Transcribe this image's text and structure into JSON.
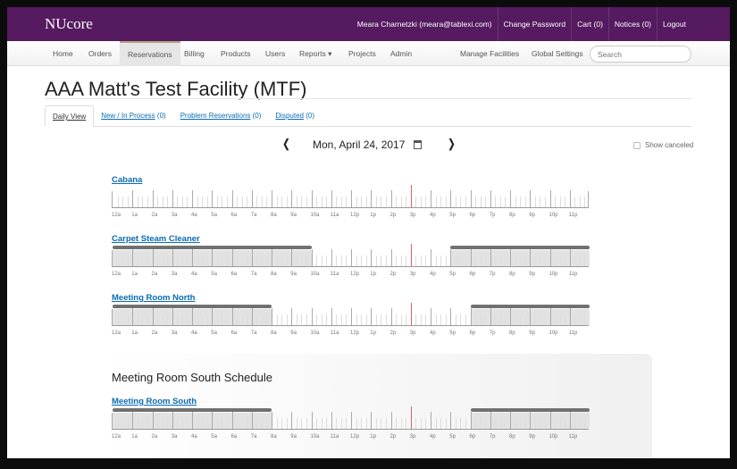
{
  "header": {
    "logo": "NUcore",
    "links": [
      "Meara Charnetzki (meara@tablexi.com)",
      "Change Password",
      "Cart (0)",
      "Notices (0)",
      "Logout"
    ],
    "color": "#551a5f"
  },
  "nav": {
    "items": [
      "Home",
      "Orders",
      "Reservations",
      "Billing",
      "Products",
      "Users",
      "Reports ▾",
      "Projects",
      "Admin"
    ],
    "active": "Reservations",
    "right": [
      "Manage Facilities",
      "Global Settings"
    ],
    "search_placeholder": "Search"
  },
  "page": {
    "title": "AAA Matt's Test Facility (MTF)"
  },
  "tabs": [
    {
      "label": "Daily View",
      "count": ""
    },
    {
      "label": "New / In Process",
      "count": "(0)"
    },
    {
      "label": "Problem Reservations",
      "count": "(0)"
    },
    {
      "label": "Disputed",
      "count": "(0)"
    }
  ],
  "date_nav": {
    "prev": "❬",
    "next": "❭",
    "date": "Mon, April 24, 2017",
    "show_canceled": "Show canceled",
    "show_canceled_checked": false
  },
  "hour_labels": [
    "12a",
    "1a",
    "2a",
    "3a",
    "4a",
    "5a",
    "6a",
    "7a",
    "8a",
    "9a",
    "10a",
    "11a",
    "12p",
    "1p",
    "2p",
    "3p",
    "4p",
    "5p",
    "6p",
    "7p",
    "8p",
    "9p",
    "10p",
    "11p"
  ],
  "current_hour": 15,
  "panel_title": "Meeting Room South Schedule",
  "resources": [
    {
      "name": "Cabana",
      "unavailable_hours": []
    },
    {
      "name": "Carpet Steam Cleaner",
      "unavailable_hours": [
        [
          0,
          10
        ],
        [
          17,
          24
        ]
      ]
    },
    {
      "name": "Meeting Room North",
      "unavailable_hours": [
        [
          0,
          8
        ],
        [
          18,
          24
        ]
      ]
    },
    {
      "name": "Meeting Room South",
      "unavailable_hours": [
        [
          0,
          8
        ],
        [
          18,
          24
        ]
      ]
    }
  ]
}
